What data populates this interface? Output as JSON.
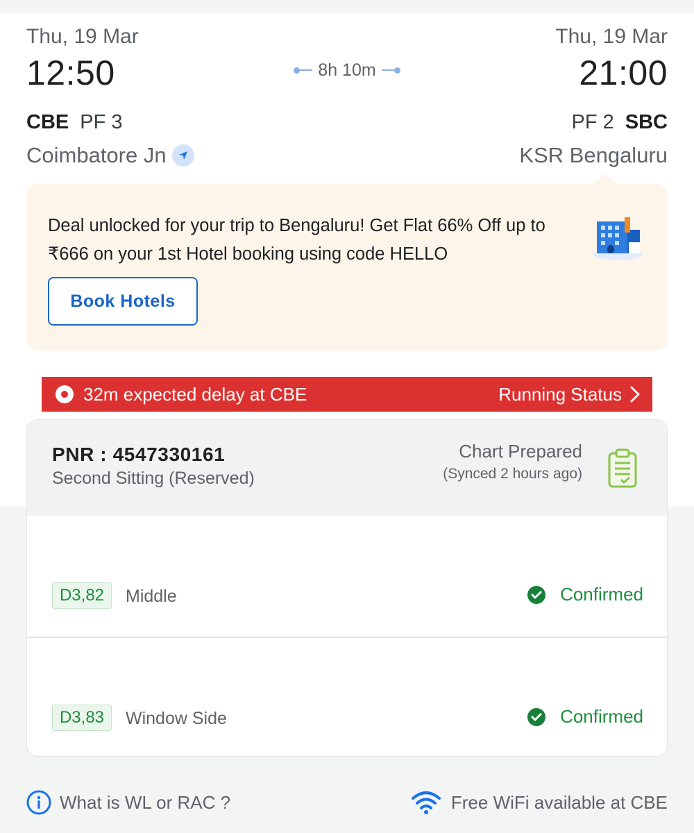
{
  "journey": {
    "departure": {
      "date": "Thu, 19 Mar",
      "time": "12:50",
      "code": "CBE",
      "platform": "PF 3",
      "station": "Coimbatore Jn"
    },
    "arrival": {
      "date": "Thu, 19 Mar",
      "time": "21:00",
      "code": "SBC",
      "platform": "PF 2",
      "station": "KSR Bengaluru"
    },
    "duration": "8h 10m"
  },
  "promo": {
    "text": "Deal unlocked for your trip to Bengaluru! Get Flat 66% Off up to ₹666 on your 1st Hotel booking using code HELLO",
    "button_label": "Book Hotels",
    "icon": "hotel-building-icon"
  },
  "delay_banner": {
    "text": "32m expected delay at CBE",
    "link_label": "Running Status",
    "color": "#dc3131"
  },
  "booking": {
    "pnr_label": "PNR : 4547330161",
    "class_label": "Second Sitting (Reserved)",
    "chart_status": "Chart Prepared",
    "synced": "(Synced 2 hours ago)",
    "passengers": [
      {
        "berth": "D3,82",
        "preference": "Middle",
        "status": "Confirmed"
      },
      {
        "berth": "D3,83",
        "preference": "Window Side",
        "status": "Confirmed"
      }
    ],
    "status_color": "#1e8e3e"
  },
  "footer": {
    "info_label": "What is WL or RAC ?",
    "wifi_label": "Free WiFi available at CBE"
  },
  "colors": {
    "accent": "#1a66c9",
    "promo_bg": "#fdf5ea"
  }
}
